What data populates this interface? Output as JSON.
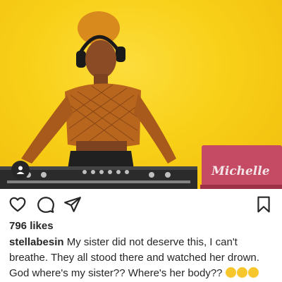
{
  "post": {
    "photo_icon": "dj-photo",
    "overlay_brand": "Michelle",
    "user_tag_icon": "person-icon"
  },
  "actions": {
    "like_icon": "heart-outline-icon",
    "comment_icon": "speech-bubble-icon",
    "share_icon": "paper-plane-icon",
    "save_icon": "bookmark-icon"
  },
  "likes": {
    "text": "796 likes"
  },
  "caption": {
    "username": "stellabesin",
    "text": "My sister did not deserve this, I can't breathe. They all stood there and watched her drown. God where's my sister?? Where's her body??",
    "emoji_icon": "crying-face-icon"
  },
  "colors": {
    "background": "#f9d21a",
    "text": "#262626",
    "laptop": "#c54a63"
  }
}
